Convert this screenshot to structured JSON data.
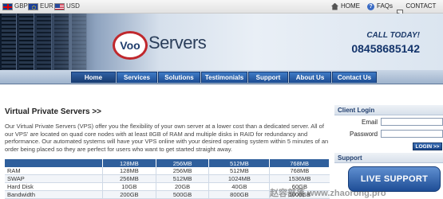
{
  "topbar": {
    "currencies": [
      {
        "code": "GBP",
        "flag": "gb-flag-icon"
      },
      {
        "code": "EUR",
        "flag": "eu-flag-icon"
      },
      {
        "code": "USD",
        "flag": "us-flag-icon"
      }
    ],
    "links": [
      {
        "label": "HOME",
        "icon": "home-icon"
      },
      {
        "label": "FAQs",
        "icon": "faq-icon"
      },
      {
        "label": "CONTACT US",
        "icon": "mail-icon"
      }
    ]
  },
  "header": {
    "logo_mark": "Voo",
    "logo_text": "Servers",
    "call_label": "CALL TODAY!",
    "phone": "08458685142"
  },
  "nav": {
    "items": [
      "Home",
      "Services",
      "Solutions",
      "Testimonials",
      "Support",
      "About Us",
      "Contact Us"
    ],
    "active": "Home"
  },
  "main": {
    "title": "Virtual Private Servers >>",
    "intro": "Our Virtual Private Servers (VPS) offer you the flexibility of your own server at a lower cost than a dedicated server. All of our VPS' are located on quad core nodes with at least 8GB of RAM and multiple disks in RAID for redundancy and performance. Our automated systems will have your VPS online with your desired operating system within 5 minutes of an order being placed so they are perfect for users who want to get started straight away.",
    "table": {
      "headers": [
        "",
        "128MB",
        "256MB",
        "512MB",
        "768MB"
      ],
      "rows": [
        [
          "RAM",
          "128MB",
          "256MB",
          "512MB",
          "768MB"
        ],
        [
          "SWAP",
          "256MB",
          "512MB",
          "1024MB",
          "1536MB"
        ],
        [
          "Hard Disk",
          "10GB",
          "20GB",
          "40GB",
          "60GB"
        ],
        [
          "Bandwidth",
          "200GB",
          "500GB",
          "800GB",
          "1000GB"
        ]
      ]
    }
  },
  "sidebar": {
    "client_login_title": "Client Login",
    "email_label": "Email",
    "password_label": "Password",
    "login_button": "LOGIN >>",
    "support_title": "Support",
    "live_support": "LIVE SUPPORT"
  },
  "watermark": "赵容部落 www.zhaorong.pro",
  "colors": {
    "nav_blue": "#1c4c92",
    "header_text": "#13346b",
    "logo_red": "#c0282d"
  }
}
